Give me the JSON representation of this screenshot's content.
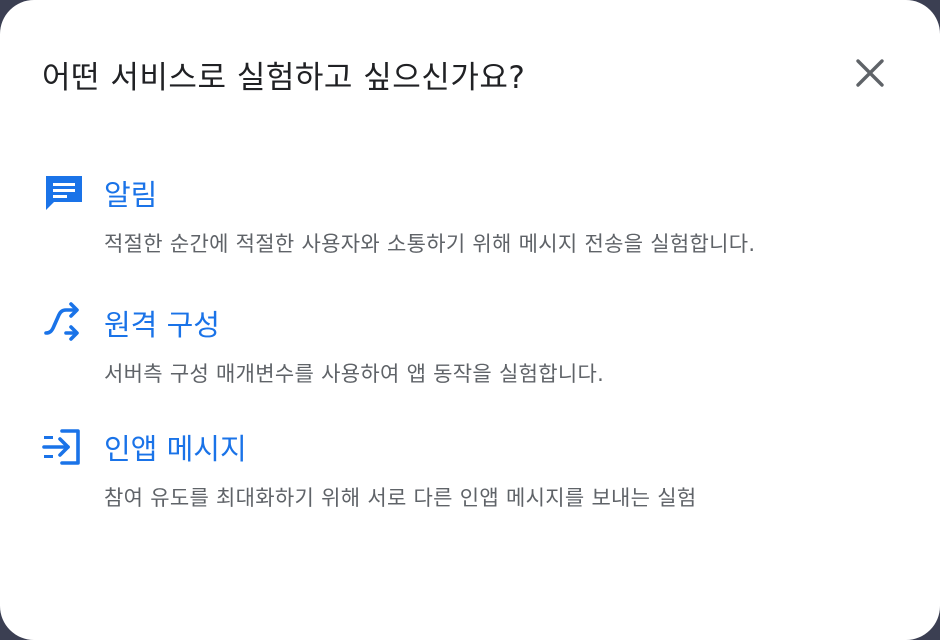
{
  "dialog": {
    "title": "어떤 서비스로 실험하고 싶으신가요?",
    "close_icon": "close-icon",
    "accent_color": "#1a73e8",
    "options": [
      {
        "icon": "message-icon",
        "title": "알림",
        "description": "적절한 순간에 적절한 사용자와 소통하기 위해 메시지 전송을 실험합니다."
      },
      {
        "icon": "remote-config-icon",
        "title": "원격 구성",
        "description": "서버측 구성 매개변수를 사용하여 앱 동작을 실험합니다."
      },
      {
        "icon": "in-app-messaging-icon",
        "title": "인앱 메시지",
        "description": "참여 유도를 최대화하기 위해 서로 다른 인앱 메시지를 보내는 실험"
      }
    ]
  }
}
